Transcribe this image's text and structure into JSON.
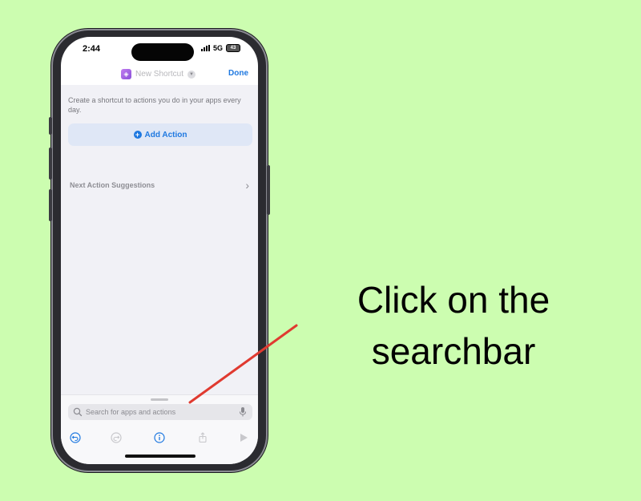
{
  "status_bar": {
    "time": "2:44",
    "network": "5G",
    "battery": "43"
  },
  "nav": {
    "title": "New Shortcut",
    "done_label": "Done"
  },
  "content": {
    "hint": "Create a shortcut to actions you do in your apps every day.",
    "add_action_label": "Add Action",
    "suggestions_label": "Next Action Suggestions"
  },
  "search": {
    "placeholder": "Search for apps and actions",
    "value": ""
  },
  "toolbar": {
    "icons": [
      "undo-icon",
      "redo-icon",
      "info-icon",
      "share-icon",
      "play-icon"
    ]
  },
  "instruction": {
    "line1": "Click on the",
    "line2": "searchbar"
  },
  "colors": {
    "background": "#ccfdb0",
    "accent": "#1e78e0",
    "arrow": "#e03a30",
    "shortcut_icon": "#a066e6"
  }
}
